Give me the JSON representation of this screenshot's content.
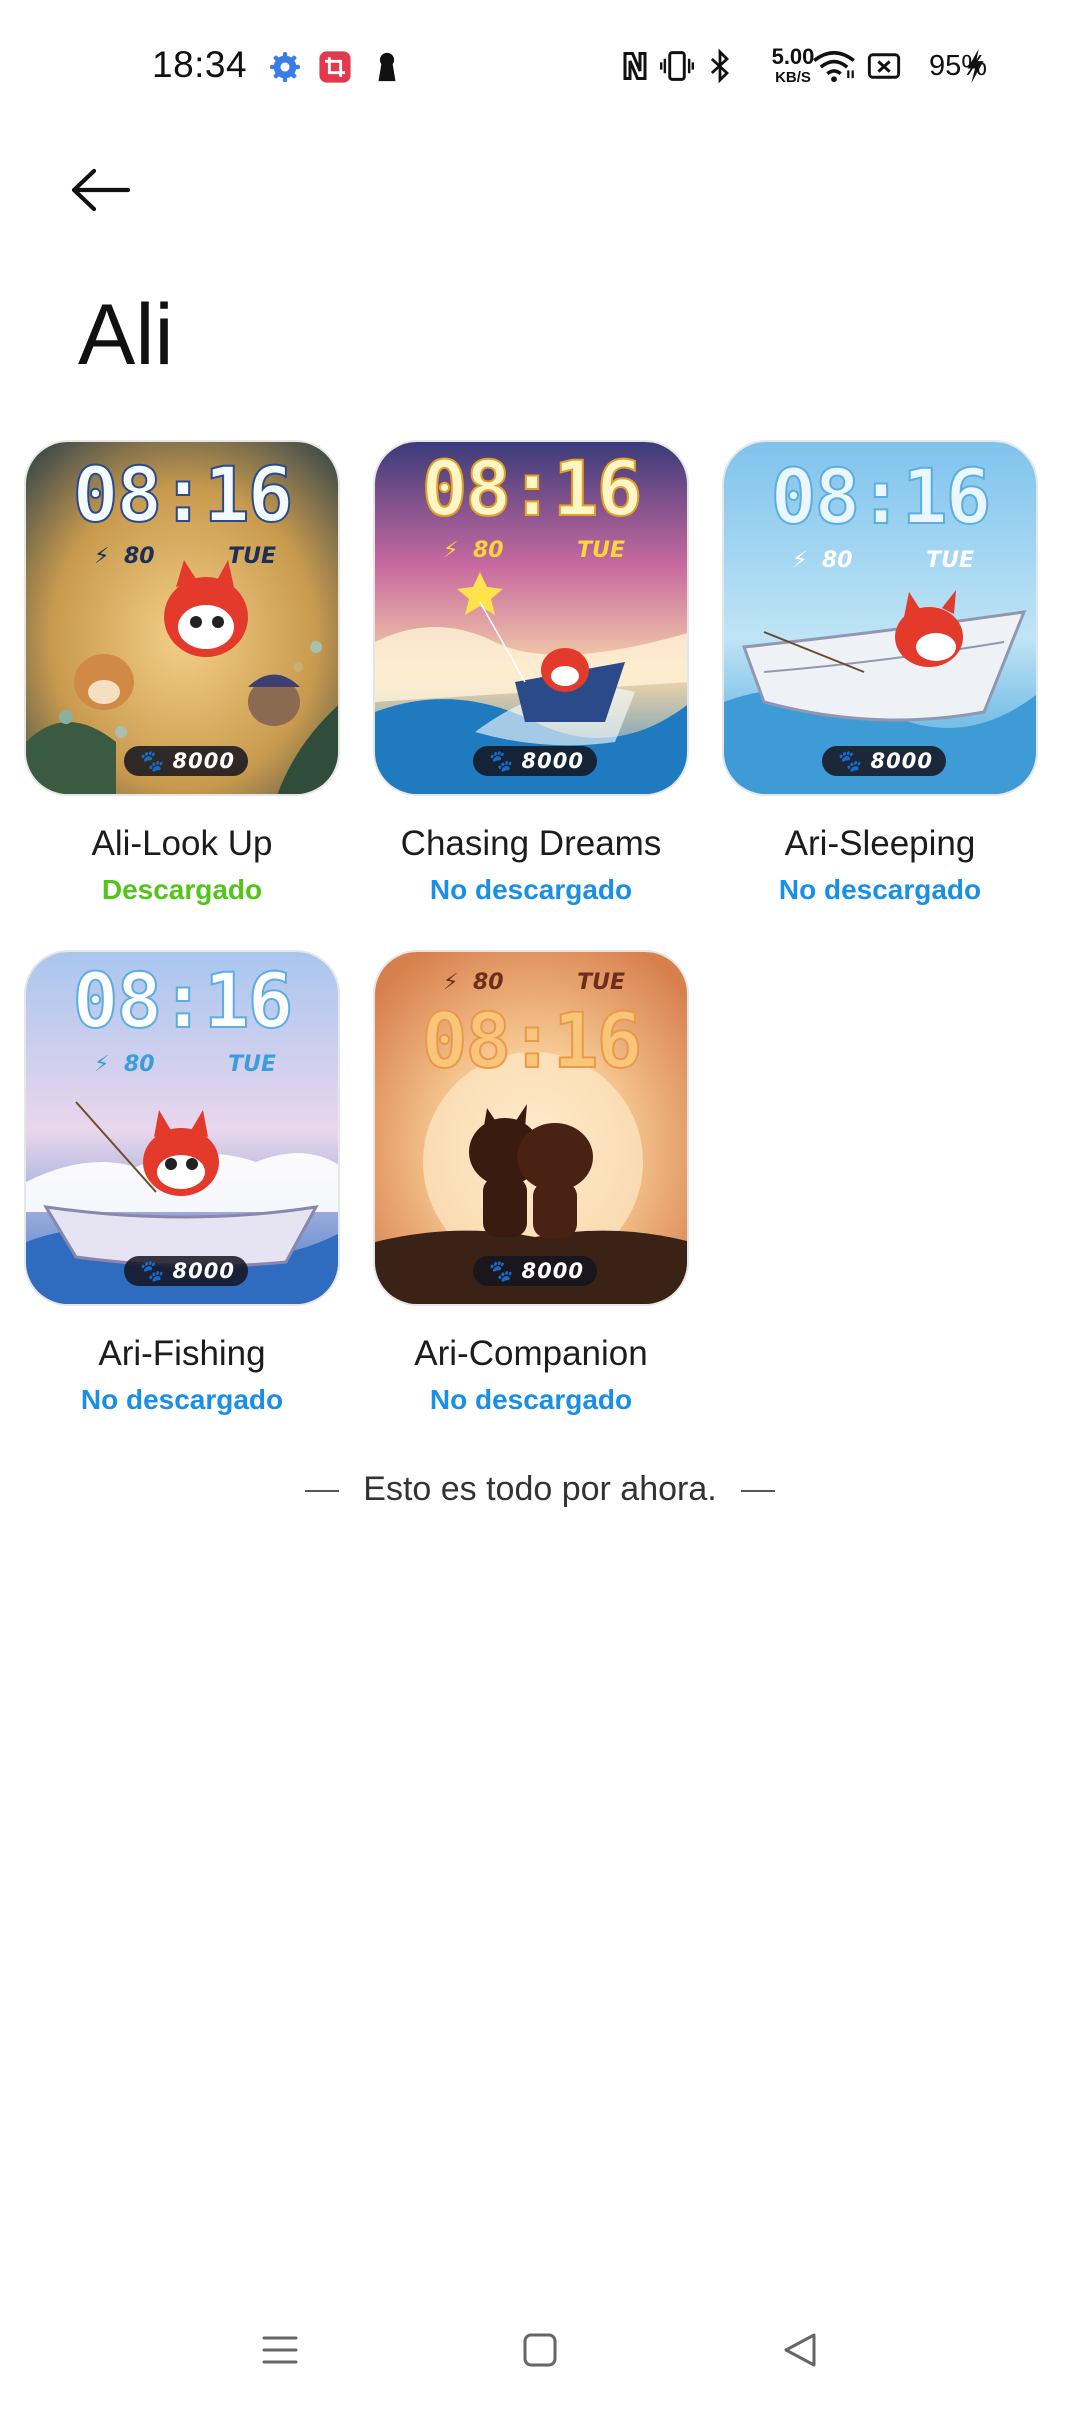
{
  "status_bar": {
    "time": "18:34",
    "net_speed_value": "5.00",
    "net_speed_unit": "KB/S",
    "battery": "95%",
    "notification_icons": [
      "gear-icon",
      "crop-icon",
      "keyhole-icon"
    ],
    "status_icons": [
      "nfc-icon",
      "vibrate-icon",
      "bluetooth-icon",
      "wifi-icon",
      "battery-saver-icon",
      "charging-icon"
    ]
  },
  "header": {
    "back_icon": "arrow-left-icon",
    "title": "Ali"
  },
  "watch_face_preview": {
    "time": "08:16",
    "battery": "80",
    "day": "TUE",
    "steps": "8000"
  },
  "faces": [
    {
      "name": "Ali-Look Up",
      "status": "Descargado",
      "status_color": "#52c41a"
    },
    {
      "name": "Chasing Dreams",
      "status": "No descargado",
      "status_color": "#1a8fe6"
    },
    {
      "name": "Ari-Sleeping",
      "status": "No descargado",
      "status_color": "#1a8fe6"
    },
    {
      "name": "Ari-Fishing",
      "status": "No descargado",
      "status_color": "#1a8fe6"
    },
    {
      "name": "Ari-Companion",
      "status": "No descargado",
      "status_color": "#1a8fe6"
    }
  ],
  "footer": {
    "text": "Esto es todo por ahora."
  },
  "nav_bar": {
    "items": [
      "menu-icon",
      "home-icon",
      "back-triangle-icon"
    ]
  }
}
